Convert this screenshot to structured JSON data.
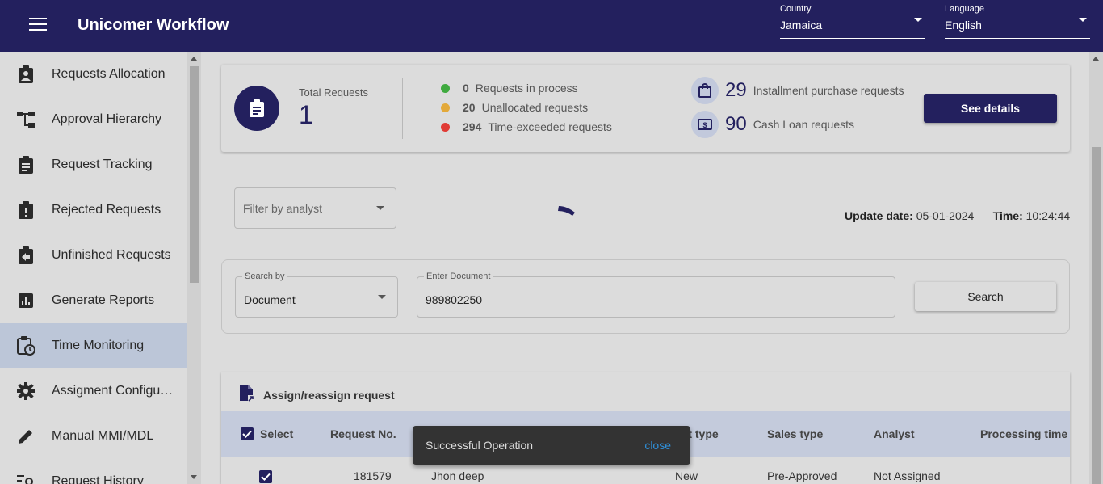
{
  "header": {
    "app_title": "Unicomer Workflow",
    "country": {
      "label": "Country",
      "value": "Jamaica"
    },
    "language": {
      "label": "Language",
      "value": "English"
    }
  },
  "sidebar": {
    "items": [
      {
        "label": "Requests Allocation",
        "icon": "clipboard-account-icon"
      },
      {
        "label": "Approval Hierarchy",
        "icon": "hierarchy-icon"
      },
      {
        "label": "Request Tracking",
        "icon": "clipboard-text-icon"
      },
      {
        "label": "Rejected Requests",
        "icon": "clipboard-alert-icon"
      },
      {
        "label": "Unfinished Requests",
        "icon": "clipboard-arrow-left-icon"
      },
      {
        "label": "Generate Reports",
        "icon": "chart-box-icon"
      },
      {
        "label": "Time Monitoring",
        "icon": "clipboard-clock-icon",
        "active": true
      },
      {
        "label": "Assigment Configur...",
        "icon": "gear-icon"
      },
      {
        "label": "Manual MMI/MDL",
        "icon": "pencil-icon"
      },
      {
        "label": "Request History",
        "icon": "list-search-icon"
      }
    ]
  },
  "summary": {
    "total_label": "Total Requests",
    "total_value": "1",
    "stats": [
      {
        "count": "0",
        "label": "Requests in process",
        "color": "#3faa3f"
      },
      {
        "count": "20",
        "label": "Unallocated requests",
        "color": "#e3a93a"
      },
      {
        "count": "294",
        "label": "Time-exceeded requests",
        "color": "#e03b35"
      }
    ],
    "types": [
      {
        "count": "29",
        "label": "Installment purchase requests",
        "icon": "shopping-bag-icon"
      },
      {
        "count": "90",
        "label": "Cash Loan requests",
        "icon": "cash-icon"
      }
    ],
    "details_button": "See details"
  },
  "filter": {
    "placeholder": "Filter by analyst"
  },
  "update": {
    "date_label": "Update date:",
    "date_value": "05-01-2024",
    "time_label": "Time:",
    "time_value": "10:24:44"
  },
  "search": {
    "by_label": "Search by",
    "by_value": "Document",
    "doc_label": "Enter Document",
    "doc_value": "989802250",
    "button": "Search"
  },
  "table": {
    "title": "Assign/reassign request",
    "columns": {
      "select": "Select",
      "request_no": "Request No.",
      "client_type": "ent type",
      "sales_type": "Sales type",
      "analyst": "Analyst",
      "processing_time": "Processing time"
    },
    "rows": [
      {
        "request_no": "181579",
        "name": "Jhon deep",
        "client_type": "New",
        "sales_type": "Pre-Approved",
        "analyst": "Not Assigned"
      }
    ]
  },
  "snackbar": {
    "message": "Successful Operation",
    "action": "close"
  },
  "colors": {
    "primary": "#23205e",
    "active_item": "#bcc6d8",
    "table_header": "#c4cbdc"
  }
}
